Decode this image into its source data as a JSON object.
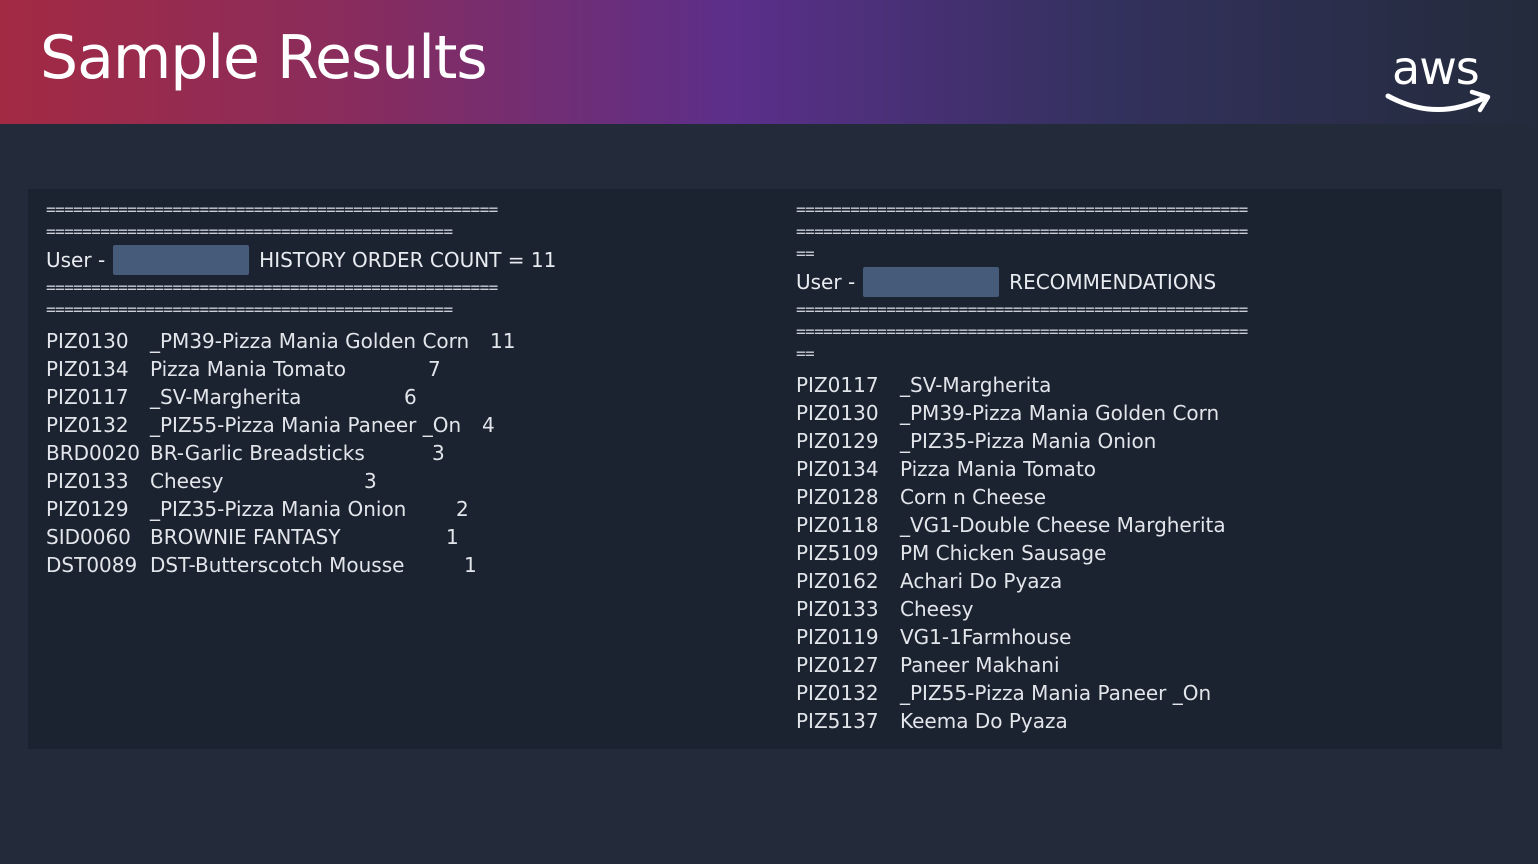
{
  "slide": {
    "title": "Sample Results",
    "logo_text": "aws"
  },
  "history": {
    "sep_top_1": "==================================================",
    "sep_top_2": "=============================================",
    "user_label": "User -",
    "heading": "HISTORY ORDER COUNT = 11",
    "sep_bottom_1": "==================================================",
    "sep_bottom_2": "=============================================",
    "items": [
      {
        "code": "PIZ0130",
        "name": "_PM39-Pizza Mania Golden Corn",
        "count": "11"
      },
      {
        "code": "PIZ0134",
        "name": "Pizza Mania Tomato",
        "count": "7"
      },
      {
        "code": "PIZ0117",
        "name": "_SV-Margherita",
        "count": "6"
      },
      {
        "code": "PIZ0132",
        "name": "_PIZ55-Pizza Mania Paneer _On",
        "count": "4"
      },
      {
        "code": "BRD0020",
        "name": "BR-Garlic Breadsticks",
        "count": "3"
      },
      {
        "code": "PIZ0133",
        "name": "Cheesy",
        "count": "3"
      },
      {
        "code": "PIZ0129",
        "name": "_PIZ35-Pizza Mania Onion",
        "count": "2"
      },
      {
        "code": "SID0060",
        "name": "BROWNIE FANTASY",
        "count": "1"
      },
      {
        "code": "DST0089",
        "name": "DST-Butterscotch Mousse",
        "count": "1"
      }
    ]
  },
  "recommendations": {
    "sep_top_1": "==================================================",
    "sep_top_2": "==================================================",
    "sep_top_3": "==",
    "user_label": "User -",
    "heading": "RECOMMENDATIONS",
    "sep_bottom_1": "==================================================",
    "sep_bottom_2": "==================================================",
    "sep_bottom_3": "==",
    "items": [
      {
        "code": "PIZ0117",
        "name": "_SV-Margherita"
      },
      {
        "code": "PIZ0130",
        "name": "_PM39-Pizza Mania Golden Corn"
      },
      {
        "code": "PIZ0129",
        "name": "_PIZ35-Pizza Mania Onion"
      },
      {
        "code": "PIZ0134",
        "name": "Pizza Mania Tomato"
      },
      {
        "code": "PIZ0128",
        "name": "Corn n Cheese"
      },
      {
        "code": "PIZ0118",
        "name": "_VG1-Double Cheese Margherita"
      },
      {
        "code": "PIZ5109",
        "name": "PM Chicken Sausage"
      },
      {
        "code": "PIZ0162",
        "name": "Achari Do Pyaza"
      },
      {
        "code": "PIZ0133",
        "name": "Cheesy"
      },
      {
        "code": "PIZ0119",
        "name": "VG1-1Farmhouse"
      },
      {
        "code": "PIZ0127",
        "name": "Paneer Makhani"
      },
      {
        "code": "PIZ0132",
        "name": "_PIZ55-Pizza Mania Paneer _On"
      },
      {
        "code": "PIZ5137",
        "name": "Keema Do Pyaza"
      }
    ]
  },
  "colors": {
    "header_start": "#a32a43",
    "header_mid": "#5b2f8a",
    "background": "#232b3b",
    "terminal": "#1b2230",
    "redaction": "#465a7a"
  }
}
